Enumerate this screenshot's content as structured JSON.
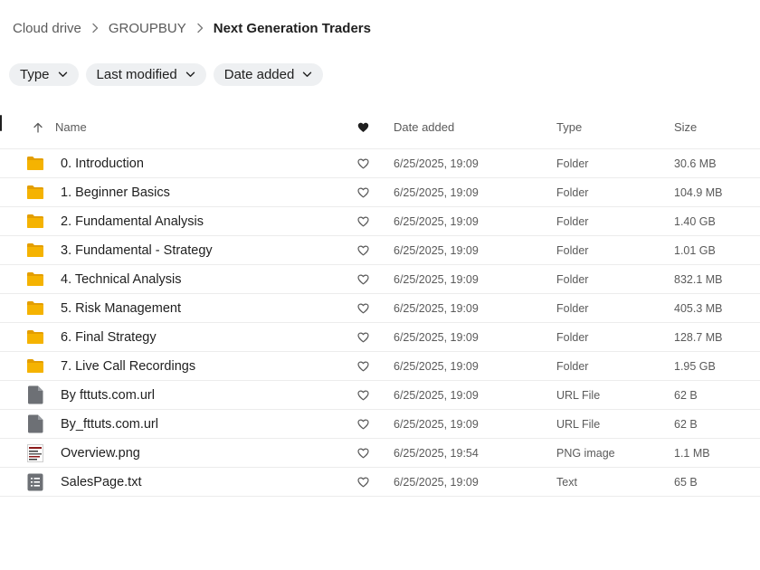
{
  "breadcrumb": {
    "items": [
      "Cloud drive",
      "GROUPBUY",
      "Next Generation Traders"
    ]
  },
  "filters": [
    {
      "label": "Type"
    },
    {
      "label": "Last modified"
    },
    {
      "label": "Date added"
    }
  ],
  "table": {
    "headers": {
      "name": "Name",
      "date_added": "Date added",
      "type": "Type",
      "size": "Size"
    },
    "rows": [
      {
        "name": "0. Introduction",
        "date": "6/25/2025, 19:09",
        "type": "Folder",
        "size": "30.6 MB",
        "icon": "folder-icon"
      },
      {
        "name": "1. Beginner Basics",
        "date": "6/25/2025, 19:09",
        "type": "Folder",
        "size": "104.9 MB",
        "icon": "folder-icon"
      },
      {
        "name": "2. Fundamental Analysis",
        "date": "6/25/2025, 19:09",
        "type": "Folder",
        "size": "1.40 GB",
        "icon": "folder-icon"
      },
      {
        "name": "3. Fundamental - Strategy",
        "date": "6/25/2025, 19:09",
        "type": "Folder",
        "size": "1.01 GB",
        "icon": "folder-icon"
      },
      {
        "name": "4. Technical Analysis",
        "date": "6/25/2025, 19:09",
        "type": "Folder",
        "size": "832.1 MB",
        "icon": "folder-icon"
      },
      {
        "name": "5. Risk Management",
        "date": "6/25/2025, 19:09",
        "type": "Folder",
        "size": "405.3 MB",
        "icon": "folder-icon"
      },
      {
        "name": "6. Final Strategy",
        "date": "6/25/2025, 19:09",
        "type": "Folder",
        "size": "128.7 MB",
        "icon": "folder-icon"
      },
      {
        "name": "7. Live Call Recordings",
        "date": "6/25/2025, 19:09",
        "type": "Folder",
        "size": "1.95 GB",
        "icon": "folder-icon"
      },
      {
        "name": "By fttuts.com.url",
        "date": "6/25/2025, 19:09",
        "type": "URL File",
        "size": "62 B",
        "icon": "generic-file-icon"
      },
      {
        "name": "By_fttuts.com.url",
        "date": "6/25/2025, 19:09",
        "type": "URL File",
        "size": "62 B",
        "icon": "generic-file-icon"
      },
      {
        "name": "Overview.png",
        "date": "6/25/2025, 19:54",
        "type": "PNG image",
        "size": "1.1 MB",
        "icon": "image-thumbnail-icon"
      },
      {
        "name": "SalesPage.txt",
        "date": "6/25/2025, 19:09",
        "type": "Text",
        "size": "65 B",
        "icon": "text-file-icon"
      }
    ]
  },
  "colors": {
    "folder": "#f5b301",
    "folder_dark": "#e39e00",
    "file": "#6d7075",
    "chip_bg": "#eef0f2",
    "border": "#ececec"
  }
}
